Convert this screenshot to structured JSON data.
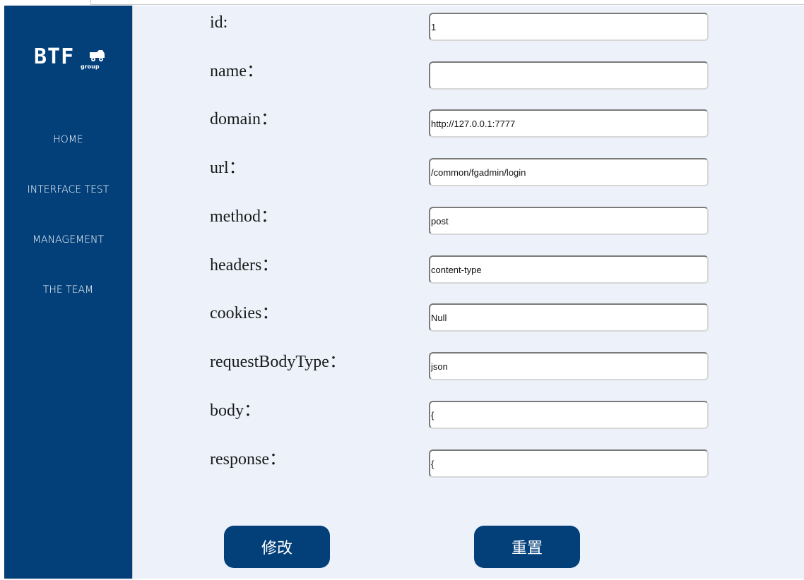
{
  "sidebar": {
    "logo": {
      "text": "BTF",
      "subtext": "group"
    },
    "nav": [
      {
        "label": "HOME"
      },
      {
        "label": "INTERFACE TEST"
      },
      {
        "label": "MANAGEMENT"
      },
      {
        "label": "THE TEAM"
      }
    ]
  },
  "form": {
    "fields": [
      {
        "label": "id:",
        "value": "1"
      },
      {
        "label": "name：",
        "value": ""
      },
      {
        "label": "domain：",
        "value": "http://127.0.0.1:7777"
      },
      {
        "label": "url：",
        "value": "/common/fgadmin/login"
      },
      {
        "label": "method：",
        "value": "post"
      },
      {
        "label": "headers：",
        "value": "content-type"
      },
      {
        "label": "cookies：",
        "value": "Null"
      },
      {
        "label": "requestBodyType：",
        "value": "json"
      },
      {
        "label": "body：",
        "value": "{"
      },
      {
        "label": "response：",
        "value": "{"
      }
    ],
    "buttons": {
      "modify": "修改",
      "reset": "重置"
    }
  },
  "colors": {
    "sidebar": "#03407a",
    "main_bg": "#edf2fa",
    "button": "#03407a"
  }
}
